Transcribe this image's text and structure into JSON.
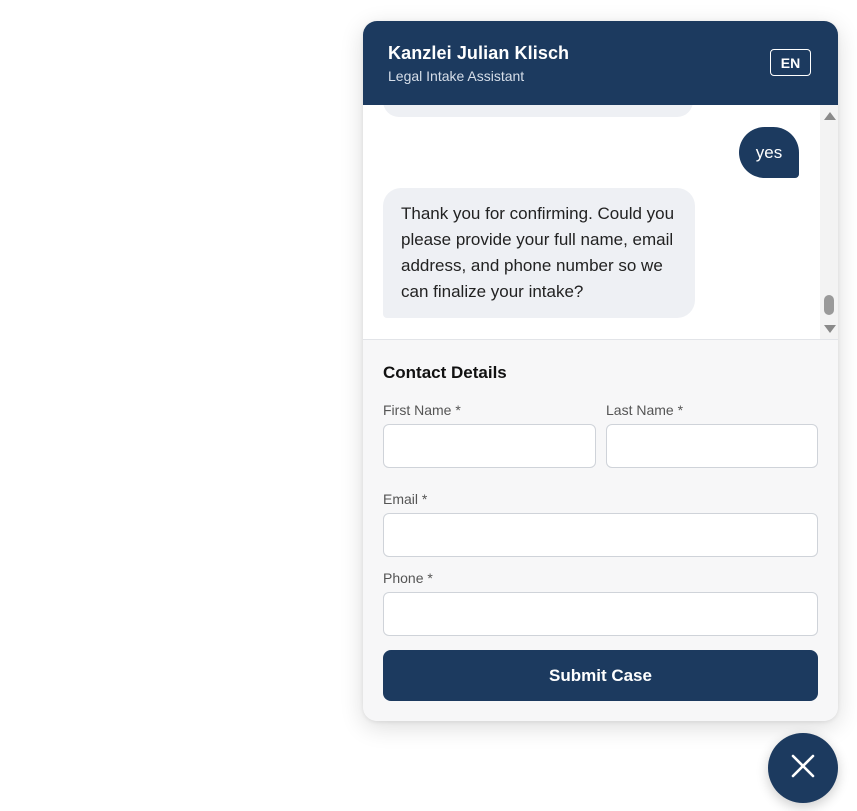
{
  "header": {
    "title": "Kanzlei Julian Klisch",
    "subtitle": "Legal Intake Assistant",
    "language_label": "EN"
  },
  "messages": [
    {
      "sender": "user",
      "text": "yes"
    },
    {
      "sender": "assistant",
      "text": "Thank you for confirming. Could you please provide your full name, email address, and phone number so we can finalize your intake?"
    }
  ],
  "contact_form": {
    "title": "Contact Details",
    "first_name": {
      "label": "First Name *",
      "value": "",
      "placeholder": ""
    },
    "last_name": {
      "label": "Last Name *",
      "value": "",
      "placeholder": ""
    },
    "email": {
      "label": "Email *",
      "value": "",
      "placeholder": ""
    },
    "phone": {
      "label": "Phone *",
      "value": "",
      "placeholder": ""
    },
    "submit_label": "Submit Case"
  },
  "icons": {
    "close": "close-icon",
    "scroll_up": "chevron-up-icon",
    "scroll_down": "chevron-down-icon"
  },
  "colors": {
    "brand": "#1c3a5f",
    "bot_bubble": "#eef0f4",
    "panel_background": "#f7f7f8"
  }
}
